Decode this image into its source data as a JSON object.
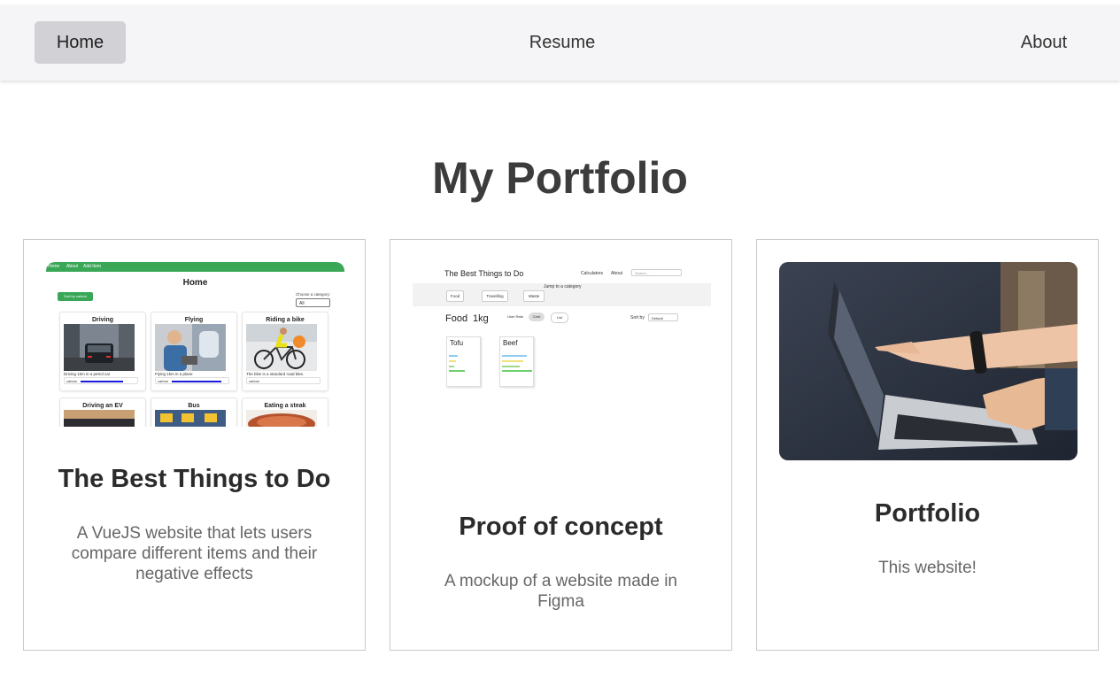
{
  "nav": {
    "home": "Home",
    "resume": "Resume",
    "about": "About"
  },
  "page": {
    "title": "My Portfolio"
  },
  "cards": [
    {
      "title": "The Best Things to Do",
      "description": "A VueJS website that lets users compare different items and their negative effects",
      "thumbnail": {
        "nav": [
          "Home",
          "About",
          "Add Item"
        ],
        "heading": "Home",
        "sort_button": "Sort by carbon",
        "choose_label": "Choose a category:",
        "select_value": "All",
        "items": [
          {
            "title": "Driving",
            "text": "Driving 1km in a petrol car",
            "carbon": "carbon"
          },
          {
            "title": "Flying",
            "text": "Flying 1km in a plane",
            "carbon": "carbon"
          },
          {
            "title": "Riding a bike",
            "text": "The bike is a standard road bike.",
            "carbon": "carbon"
          },
          {
            "title": "Driving an EV"
          },
          {
            "title": "Bus"
          },
          {
            "title": "Eating a steak"
          }
        ]
      }
    },
    {
      "title": "Proof of concept",
      "description": "A mockup of a website made in Figma",
      "thumbnail": {
        "site_title": "The Best Things to Do",
        "calculators": "Calculators",
        "about": "About",
        "search_placeholder": "Search...",
        "jump_label": "Jump to a category",
        "chips": [
          "Food",
          "Travelling",
          "Waste"
        ],
        "food": "Food",
        "weight": "1kg",
        "toggles": [
          "User Rate",
          "Card",
          "List"
        ],
        "sort_by": "Sort by",
        "sort_value": "Default",
        "items": [
          {
            "title": "Tofu",
            "unit": "1 kg"
          },
          {
            "title": "Beef",
            "unit": "1 kg"
          }
        ]
      }
    },
    {
      "title": "Portfolio",
      "description": "This website!"
    }
  ],
  "colors": {
    "nav_bg": "#f5f5f7",
    "nav_active": "#d1d1d6",
    "green": "#3aa757"
  }
}
